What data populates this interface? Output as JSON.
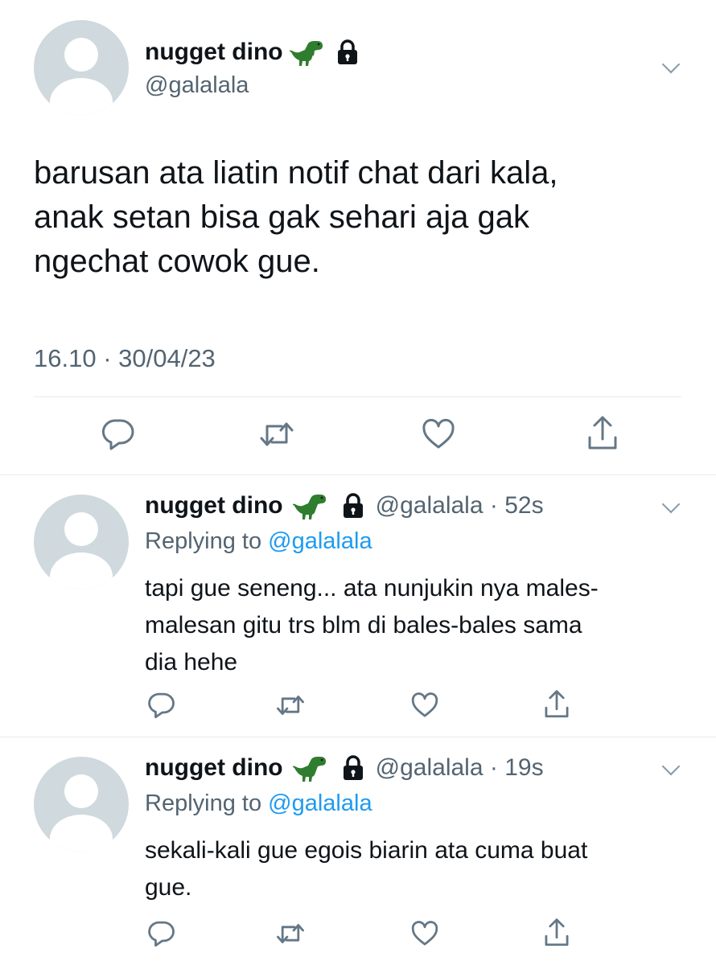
{
  "main_tweet": {
    "author_name": "nugget dino",
    "author_handle": "@galalala",
    "text_lines": [
      "barusan ata liatin notif chat dari kala,",
      "anak setan bisa gak sehari aja gak",
      "ngechat cowok gue."
    ],
    "timestamp": "16.10 · 30/04/23"
  },
  "replies": [
    {
      "author_name": "nugget dino",
      "author_handle": "@galalala",
      "time": "· 52s",
      "replying_prefix": "Replying to",
      "replying_handle": "@galalala",
      "text_lines": [
        "tapi gue seneng... ata nunjukin nya males-",
        "malesan gitu trs blm di bales-bales sama",
        "dia hehe"
      ]
    },
    {
      "author_name": "nugget dino",
      "author_handle": "@galalala",
      "time": "· 19s",
      "replying_prefix": "Replying to",
      "replying_handle": "@galalala",
      "text_lines": [
        "sekali-kali gue egois biarin ata cuma buat",
        "gue."
      ]
    }
  ],
  "icons": [
    "dinosaur-emoji-icon",
    "lock-icon",
    "chevron-down-icon",
    "reply-icon",
    "retweet-icon",
    "like-icon",
    "share-icon"
  ],
  "colors": {
    "text": "#0f1419",
    "secondary": "#536471",
    "link": "#1d9bf0",
    "avatar_bg": "#cfd9de",
    "divider": "#e6ecf0"
  }
}
